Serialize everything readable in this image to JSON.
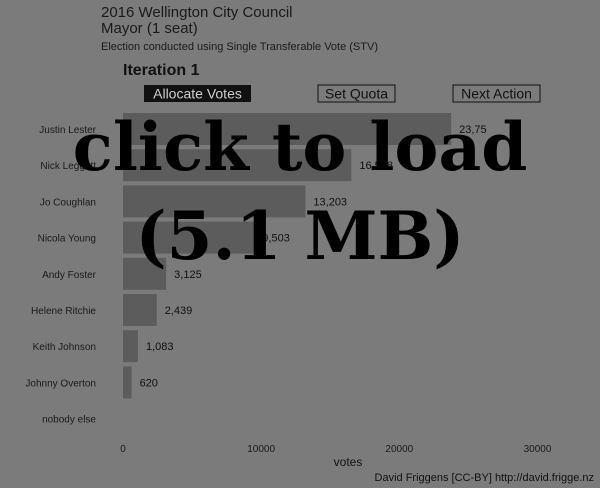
{
  "header": {
    "title": "2016 Wellington City Council",
    "subtitle": "Mayor (1 seat)",
    "caption": "Election conducted using Single Transferable Vote (STV)"
  },
  "iteration_label": "Iteration 1",
  "buttons": {
    "allocate": "Allocate Votes",
    "quota": "Set Quota",
    "next": "Next Action"
  },
  "credit": "David Friggens [CC-BY] http://david.frigge.nz",
  "overlay": {
    "line1": "click to load",
    "line2": "(5.1 MB)"
  },
  "colors": {
    "background": "#7b7b7b",
    "bar": "#5c5c5c",
    "text": "#1a1a1a",
    "active_button_bg": "#111111",
    "active_button_text": "#cccccc"
  },
  "chart_data": {
    "type": "bar",
    "orientation": "horizontal",
    "categories": [
      "Justin Lester",
      "Nick Leggett",
      "Jo Coughlan",
      "Nicola Young",
      "Andy Foster",
      "Helene Ritchie",
      "Keith Johnson",
      "Johnny Overton",
      "nobody else"
    ],
    "values": [
      23750,
      16528,
      13203,
      9503,
      3125,
      2439,
      1083,
      620,
      0
    ],
    "value_labels": [
      "23,75",
      "16,528",
      "13,203",
      "9,503",
      "3,125",
      "2,439",
      "1,083",
      "620",
      ""
    ],
    "xlabel": "votes",
    "xlim": [
      0,
      32000
    ],
    "xticks": [
      0,
      10000,
      20000,
      30000
    ],
    "xtick_labels": [
      "0",
      "10000",
      "20000",
      "30000"
    ],
    "grid": false
  }
}
